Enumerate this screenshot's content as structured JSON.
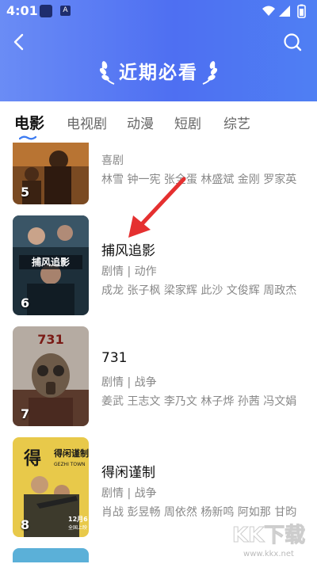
{
  "status": {
    "time": "4:01",
    "a_badge": "A"
  },
  "header": {
    "title": "近期必看"
  },
  "tabs": [
    {
      "label": "电影",
      "active": true
    },
    {
      "label": "电视剧"
    },
    {
      "label": "动漫"
    },
    {
      "label": "短剧"
    },
    {
      "label": "综艺"
    }
  ],
  "movies": [
    {
      "rank": "5",
      "title": "",
      "genre": "喜剧",
      "cast": "林雪 钟一宪 张全蛋 林盛斌 金刚 罗家英"
    },
    {
      "rank": "6",
      "title": "捕风追影",
      "genre": "剧情 | 动作",
      "cast": "成龙 张子枫 梁家辉 此沙 文俊辉 周政杰"
    },
    {
      "rank": "7",
      "title": "731",
      "genre": "剧情 | 战争",
      "cast": "姜武 王志文 李乃文 林子烨 孙茜 冯文娟"
    },
    {
      "rank": "8",
      "title": "得闲谨制",
      "genre": "剧情 | 战争",
      "cast": "肖战 彭昱畅 周依然 杨新鸣 阿如那 甘昀"
    }
  ],
  "posters": {
    "poster_6_text": "捕风追影",
    "poster_7_text": "731",
    "poster_8_text": "得闲谨制",
    "poster_8_sub": "GEZHI TOWN",
    "poster_8_date": "12月6日",
    "poster_8_date2": "全国上映"
  },
  "watermark": {
    "text": "KK下载",
    "url": "www.kkx.net"
  },
  "colors": {
    "header_start": "#6a8cf5",
    "header_end": "#4e6ff2",
    "accent": "#3d7cf2",
    "arrow": "#e53030"
  }
}
